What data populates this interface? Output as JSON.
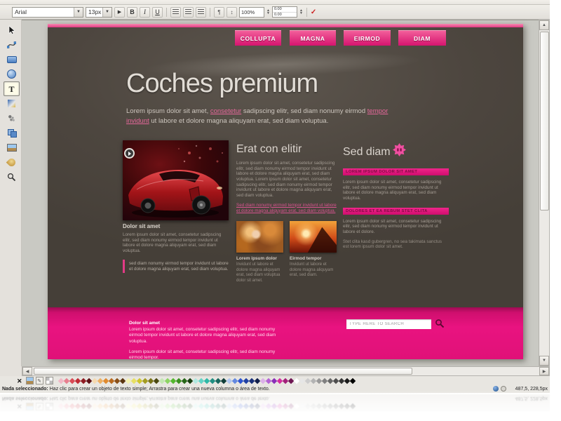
{
  "toolbar": {
    "font_family": "Arial",
    "font_size": "13px",
    "bold": "B",
    "italic": "I",
    "underline": "U",
    "line_height": "100%",
    "spacing_top": "0.00",
    "spacing_bottom": "0.00"
  },
  "tools": {
    "text_glyph": "T"
  },
  "design": {
    "nav_tabs": [
      {
        "label": "COLLUPTA"
      },
      {
        "label": "MAGNA"
      },
      {
        "label": "EIRMOD"
      },
      {
        "label": "DIAM"
      }
    ],
    "hero": {
      "title": "Coches premium",
      "intro_pre": "Lorem ipsum dolor sit amet, ",
      "link1": "consetetur",
      "intro_mid": " sadipscing elitr, sed diam nonumy eirmod ",
      "link2": "tempor invidunt",
      "intro_post": " ut labore et dolore magna aliquyam erat, sed diam voluptua."
    },
    "car_section": {
      "caption_title": "Dolor sit amet",
      "caption_text": "Lorem ipsum dolor sit amet, consetetur sadipscing elitr, sed diam nonumy eirmod tempor invidunt ut labore et dolore magna aliquyam erat, sed diam voluptua.",
      "quote": "sed diam nonumy eirmod tempor invidunt ut labore et dolore magna aliquyam erat, sed diam voluptua."
    },
    "mid_column": {
      "heading": "Erat con elitir",
      "body": "Lorem ipsum dolor sit amet, consetetur sadipscing elitr, sed diam nonumy eirmod tempor invidunt ut labore et dolore magna aliquyam erat, sed diam voluptua. Lorem ipsum dolor sit amet, consetetur sadipscing elitr, sed diam nonumy eirmod tempor invidunt ut labore et dolore magna aliquyam erat, sed diam voluptua.",
      "link_text": "Sed diam nonumy eirmod tempor invidunt ut labore et dolore magna aliquyam erat, sed diam voluptua.",
      "figures": [
        {
          "title": "Lorem ipsum dolor",
          "text": "Invidunt ut labore et dolore magna aliquyam erat, sed diam voluptua dolor sit amet."
        },
        {
          "title": "Eirmod tempor",
          "text": "Invidunt ut labore et dolore magna aliquyam erat, sed diam."
        }
      ]
    },
    "right_column": {
      "heading": "Sed diam",
      "bar1": "LOREM IPSUM DOLOR SIT AMET",
      "body1": "Lorem ipsum dolor sit amet, consetetur sadipscing elitr, sed diam nonumy eirmod tempor invidunt ut labore et dolore magna aliquyam erat, sed diam voluptua.",
      "bar2": "DOLORES ET EA REBUM STET CLITA",
      "body2": "Lorem ipsum dolor sit amet, consetetur sadipscing elitr, sed diam nonumy eirmod tempor invidunt ut labore et dolore.",
      "body3": "Stet clita kasd gubergren, no sea takimata sanctus est lorem ipsum dolor sit amet."
    },
    "footer": {
      "heading": "Dolor sit amet",
      "line1": "Lorem ipsum dolor sit amet, consetetur sadipscing elitr, sed diam nonumy eirmod tempor invidunt ut labore et dolore magna aliquyam erat, sed diam voluptua.",
      "line2": "Lorem ipsum dolor sit amet, consetetur sadipscing elitr, sed diam nonumy eirmod tempor.",
      "search_placeholder": "TYPE HERE TO SEARCH"
    }
  },
  "statusbar": {
    "selection": "Nada seleccionado:",
    "hint": "Haz clic para crear un objeto de texto simple; Arrastra para crear una nueva columna o área de texto.",
    "coords": "487,5, 228,5px"
  },
  "palette": {
    "colors": [
      "#f2b8c6",
      "#e87f8f",
      "#d94a55",
      "#bf2a33",
      "#8f1b22",
      "#5c1015",
      "#f5d9b0",
      "#eeb063",
      "#e08a2e",
      "#b86a20",
      "#8a4f18",
      "#5a3410",
      "#f5f2b0",
      "#e8e063",
      "#cfc52e",
      "#a39b20",
      "#787218",
      "#4a4710",
      "#c2e8b0",
      "#8cd463",
      "#54b82e",
      "#3a8f20",
      "#276618",
      "#173d10",
      "#b0e8e0",
      "#63d4c6",
      "#2eb8a7",
      "#208f82",
      "#18665d",
      "#103d38",
      "#b0c6f0",
      "#6388e0",
      "#2e55cf",
      "#2040a3",
      "#182f78",
      "#101d4a",
      "#dcb0e8",
      "#b463d4",
      "#8a2eb8",
      "#d42ea0",
      "#a3207a",
      "#6e1552",
      "#ffffff",
      "#e6e6e6",
      "#cccccc",
      "#b3b3b3",
      "#999999",
      "#808080",
      "#666666",
      "#4d4d4d",
      "#333333",
      "#1a1a1a",
      "#000000"
    ]
  },
  "accent": {
    "pink": "#e5127d",
    "dark_background": "#4a443c"
  }
}
